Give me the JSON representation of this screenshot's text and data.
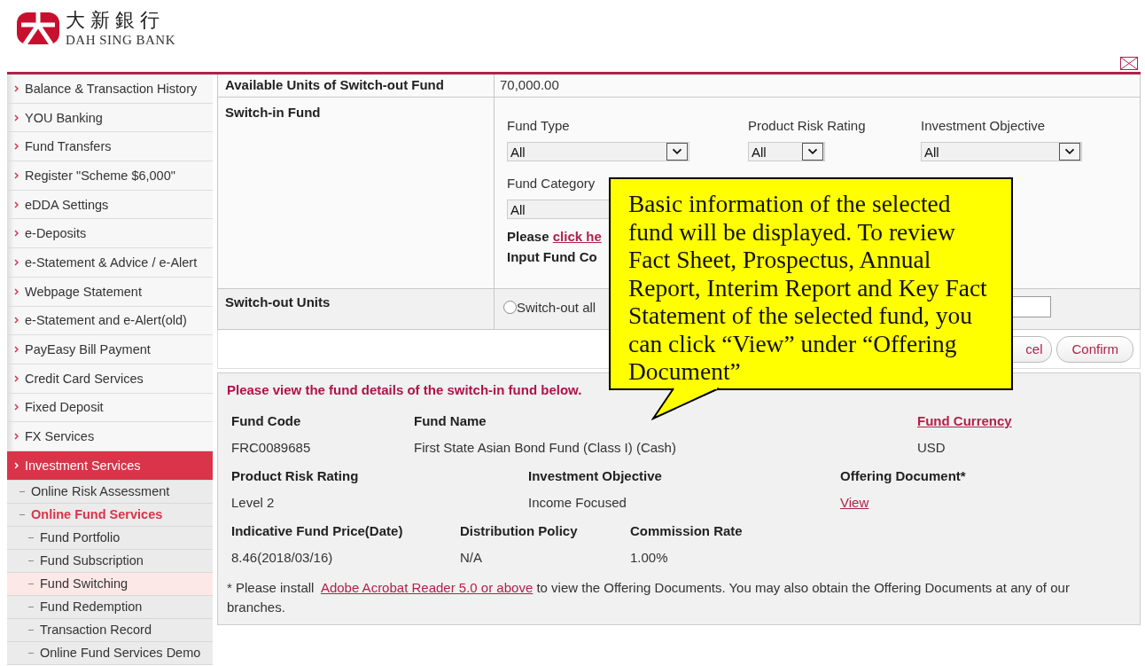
{
  "brand": {
    "chinese_name": "大新銀行",
    "english_name": "DAH SING BANK"
  },
  "sidebar": {
    "items": [
      {
        "label": "Balance & Transaction History",
        "selected": false
      },
      {
        "label": "YOU Banking",
        "selected": false
      },
      {
        "label": "Fund Transfers",
        "selected": false
      },
      {
        "label": "Register \"Scheme $6,000\"",
        "selected": false
      },
      {
        "label": "eDDA Settings",
        "selected": false
      },
      {
        "label": "e-Deposits",
        "selected": false
      },
      {
        "label": "e-Statement & Advice / e-Alert",
        "selected": false
      },
      {
        "label": "Webpage Statement",
        "selected": false
      },
      {
        "label": "e-Statement and e-Alert(old)",
        "selected": false
      },
      {
        "label": "PayEasy Bill Payment",
        "selected": false
      },
      {
        "label": "Credit Card Services",
        "selected": false
      },
      {
        "label": "Fixed Deposit",
        "selected": false
      },
      {
        "label": "FX Services",
        "selected": false
      },
      {
        "label": "Investment Services",
        "selected": true,
        "children": [
          {
            "label": "Online Risk Assessment",
            "selected": false
          },
          {
            "label": "Online Fund Services",
            "selected": true,
            "children": [
              {
                "label": "Fund Portfolio",
                "selected": false
              },
              {
                "label": "Fund Subscription",
                "selected": false
              },
              {
                "label": "Fund Switching",
                "selected": true
              },
              {
                "label": "Fund Redemption",
                "selected": false
              },
              {
                "label": "Transaction Record",
                "selected": false
              },
              {
                "label": "Online Fund Services Demo",
                "selected": false
              }
            ]
          }
        ]
      }
    ]
  },
  "form": {
    "available_units": {
      "label": "Available Units of Switch-out Fund",
      "value": "70,000.00"
    },
    "switch_in": {
      "label": "Switch-in Fund",
      "filters": [
        {
          "label": "Fund Type",
          "value": "All"
        },
        {
          "label": "Product Risk Rating",
          "value": "All"
        },
        {
          "label": "Investment Objective",
          "value": "All"
        },
        {
          "label": "Fund Category",
          "value": "All"
        }
      ],
      "instruction_prefix": "Please",
      "instruction_link": "click he",
      "input_label": "Input Fund Co"
    },
    "switch_out_units": {
      "label": "Switch-out Units",
      "option": "Switch-out all",
      "selected": false
    },
    "buttons": [
      "cel",
      "Confirm"
    ]
  },
  "callout": {
    "text": "Basic information of the selected fund will be displayed. To review Fact Sheet, Prospectus, Annual Report, Interim Report and Key Fact Statement of the selected fund, you can click “View” under “Offering Document”"
  },
  "details": {
    "heading": "Please view the fund details of the switch-in fund below.",
    "rows": [
      [
        {
          "label": "Fund Code",
          "value": "FRC0089685"
        },
        {
          "label": "Fund Name",
          "value": "First State Asian Bond Fund (Class I) (Cash)"
        },
        {
          "label": "Fund Currency",
          "value": "USD",
          "kind": "link_label"
        }
      ],
      [
        {
          "label": "Product Risk Rating",
          "value": "Level 2"
        },
        {
          "label": "Investment Objective",
          "value": "Income Focused"
        },
        {
          "label": "Offering Document*",
          "value": "View",
          "kind": "link_value"
        }
      ],
      [
        {
          "label": "Indicative Fund Price(Date)",
          "value": "8.46(2018/03/16)"
        },
        {
          "label": "Distribution Policy",
          "value": "N/A"
        },
        {
          "label": "Commission Rate",
          "value": "1.00%"
        }
      ]
    ],
    "note_prefix": "* Please install",
    "note_link": "Adobe Acrobat Reader 5.0 or above",
    "note_suffix": "to view the Offering Documents. You may also obtain the Offering Documents at any of our branches."
  }
}
